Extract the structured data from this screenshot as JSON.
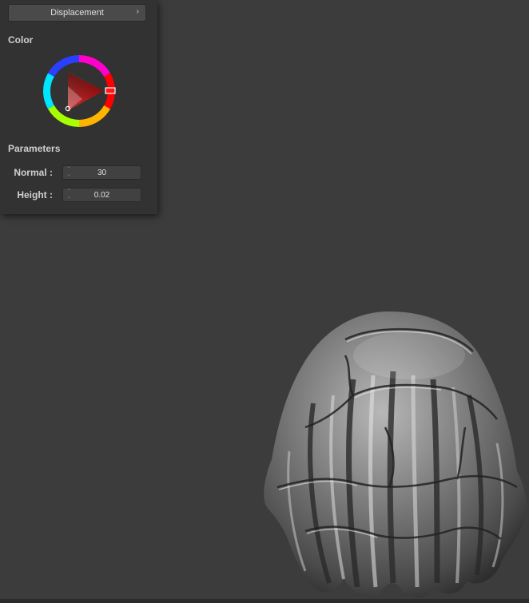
{
  "panel": {
    "dropdown_label": "Displacement",
    "dropdown_chevron": "›",
    "color_title": "Color",
    "params_title": "Parameters",
    "params": [
      {
        "label": "Normal :",
        "value": "30"
      },
      {
        "label": "Height :",
        "value": "0.02"
      }
    ]
  },
  "color": {
    "selected_hue_hex": "#ff1a1a",
    "icons": [
      "color-wheel-icon",
      "spinner-icon",
      "chevron-right-icon"
    ]
  }
}
